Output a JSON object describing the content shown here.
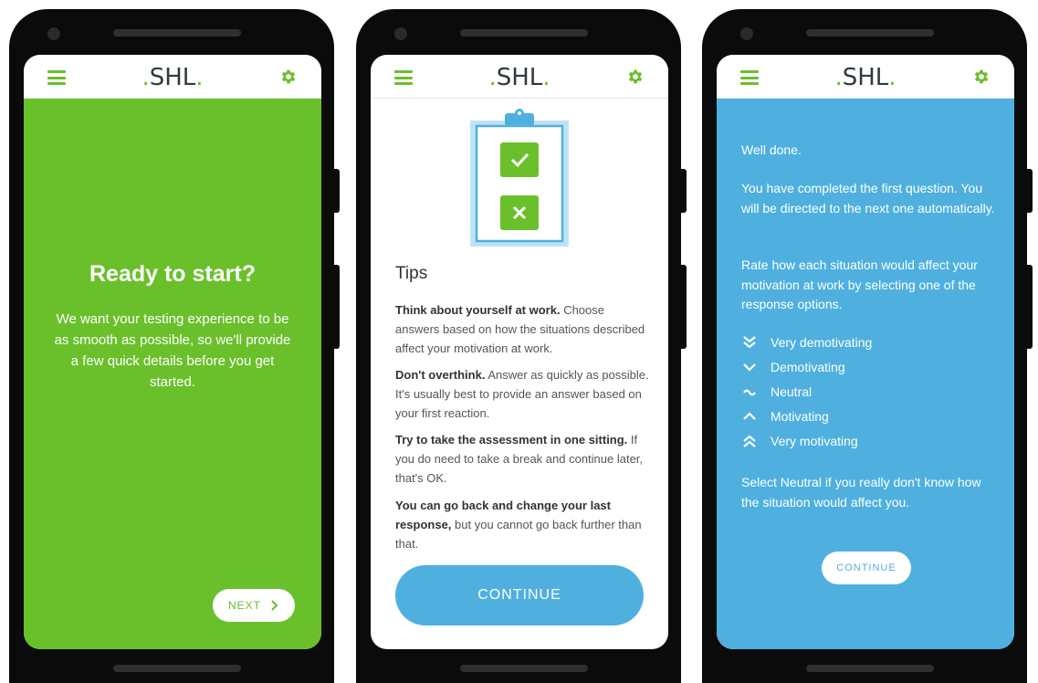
{
  "brand": {
    "logo_text": "SHL",
    "accent_green": "#6ac02b",
    "accent_blue": "#4fb0e0"
  },
  "screen1": {
    "title": "Ready to start?",
    "body": "We want your testing experience to be as smooth as possible, so we'll provide a few quick details before you get started.",
    "next_label": "NEXT",
    "next_icon": "chevron-right-icon"
  },
  "screen2": {
    "illustration_icons": [
      "check-icon",
      "x-icon"
    ],
    "tips_title": "Tips",
    "tips": [
      {
        "bold": "Think about yourself at work.",
        "text": " Choose answers based on how the situations described affect your motivation at work."
      },
      {
        "bold": "Don't overthink.",
        "text": " Answer as quickly as possible. It's usually best to provide an answer based on your first reaction."
      },
      {
        "bold": "Try to take the assessment in one sitting.",
        "text": " If you do need to take a break and continue later, that's OK."
      },
      {
        "bold": "You can go back and change your last response,",
        "text": " but you cannot go back further than that."
      }
    ],
    "continue_label": "CONTINUE"
  },
  "screen3": {
    "para1": "Well done.",
    "para2": "You have completed the first question. You will be directed to the next one automatically.",
    "para3": "Rate how each situation would affect your motivation at work by selecting one of the response options.",
    "options": [
      {
        "icon": "double-chevron-down-icon",
        "label": "Very demotivating"
      },
      {
        "icon": "chevron-down-icon",
        "label": "Demotivating"
      },
      {
        "icon": "tilde-icon",
        "label": "Neutral"
      },
      {
        "icon": "chevron-up-icon",
        "label": "Motivating"
      },
      {
        "icon": "double-chevron-up-icon",
        "label": "Very motivating"
      }
    ],
    "para4": "Select Neutral if you really don't know how the situation would affect you.",
    "continue_label": "CONTINUE"
  }
}
